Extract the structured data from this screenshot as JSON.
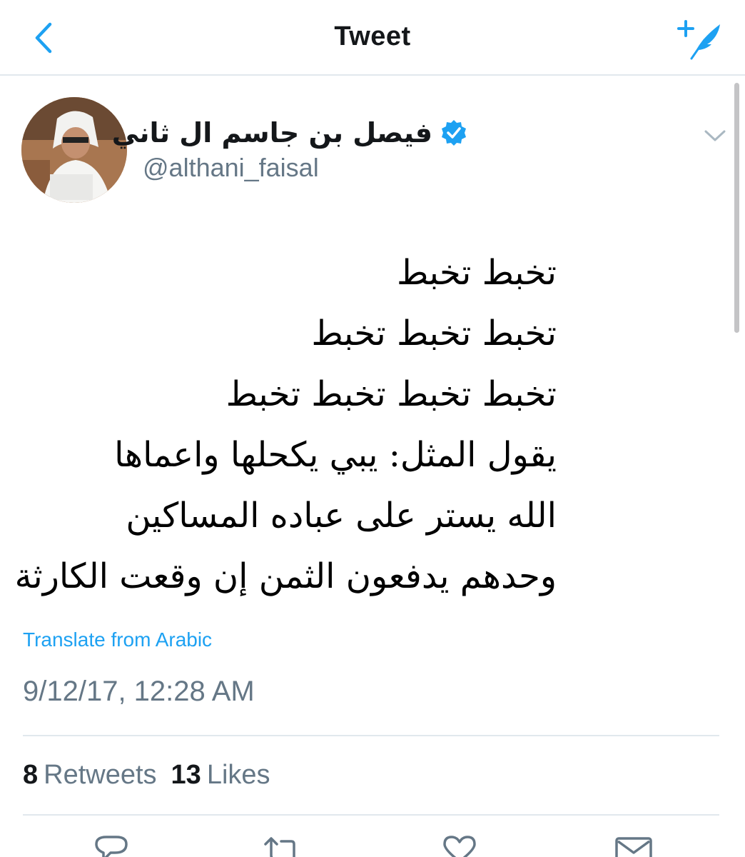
{
  "header": {
    "title": "Tweet",
    "back_icon": "chevron-left-icon",
    "compose_icon": "compose-tweet-icon"
  },
  "tweet": {
    "author": {
      "display_name": "فيصل بن جاسم ال ثاني",
      "handle": "@althani_faisal",
      "verified": true,
      "avatar_icon": "user-avatar"
    },
    "body_lines": [
      "تخبط تخبط",
      "تخبط تخبط تخبط",
      "تخبط تخبط تخبط تخبط",
      "يقول المثل: يبي يكحلها واعماها",
      "الله يستر على عباده المساكين",
      "وحدهم يدفعون الثمن إن وقعت الكارثة"
    ],
    "translate_label": "Translate from Arabic",
    "timestamp": "9/12/17, 12:28 AM",
    "stats": {
      "retweets_count": "8",
      "retweets_label": "Retweets",
      "likes_count": "13",
      "likes_label": "Likes"
    }
  },
  "actions": [
    {
      "icon": "reply-icon"
    },
    {
      "icon": "retweet-icon"
    },
    {
      "icon": "like-icon"
    },
    {
      "icon": "share-icon"
    }
  ],
  "colors": {
    "accent": "#1da1f2",
    "secondary_text": "#657786",
    "divider": "#e1e8ed"
  }
}
